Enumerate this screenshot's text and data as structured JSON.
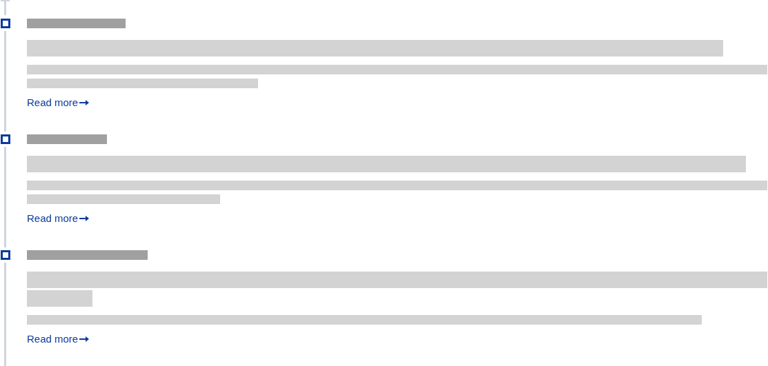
{
  "timeline": {
    "entries": [
      {
        "link": "Read more"
      },
      {
        "link": "Read more"
      },
      {
        "link": "Read more"
      }
    ]
  }
}
